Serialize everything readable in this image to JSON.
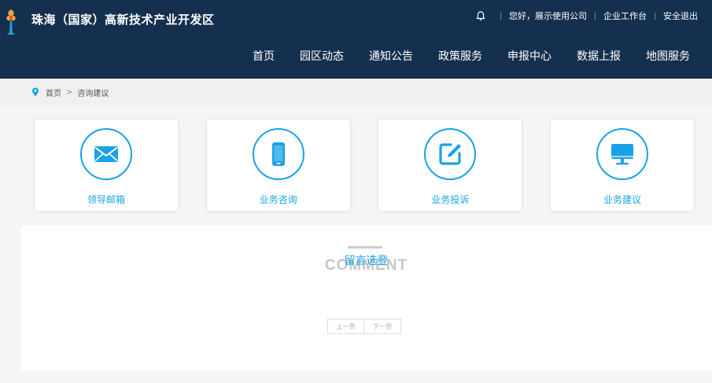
{
  "header": {
    "site_title": "珠海（国家）高新技术产业开发区",
    "greeting": "您好，展示使用公司",
    "workbench": "企业工作台",
    "logout": "安全退出"
  },
  "nav": [
    "首页",
    "园区动态",
    "通知公告",
    "政策服务",
    "申报中心",
    "数据上报",
    "地图服务"
  ],
  "breadcrumb": {
    "home": "首页",
    "separator": ">",
    "current": "咨询建议"
  },
  "cards": [
    {
      "label": "领导邮箱",
      "icon": "envelope-icon"
    },
    {
      "label": "业务咨询",
      "icon": "mobile-phone-icon"
    },
    {
      "label": "业务投诉",
      "icon": "edit-icon"
    },
    {
      "label": "业务建议",
      "icon": "monitor-icon"
    }
  ],
  "comments": {
    "en_title": "COMMENT",
    "cn_title": "留言选登",
    "prev": "上一页",
    "next": "下一页"
  },
  "colors": {
    "header_bg": "#15304f",
    "accent": "#1aa2e6"
  }
}
